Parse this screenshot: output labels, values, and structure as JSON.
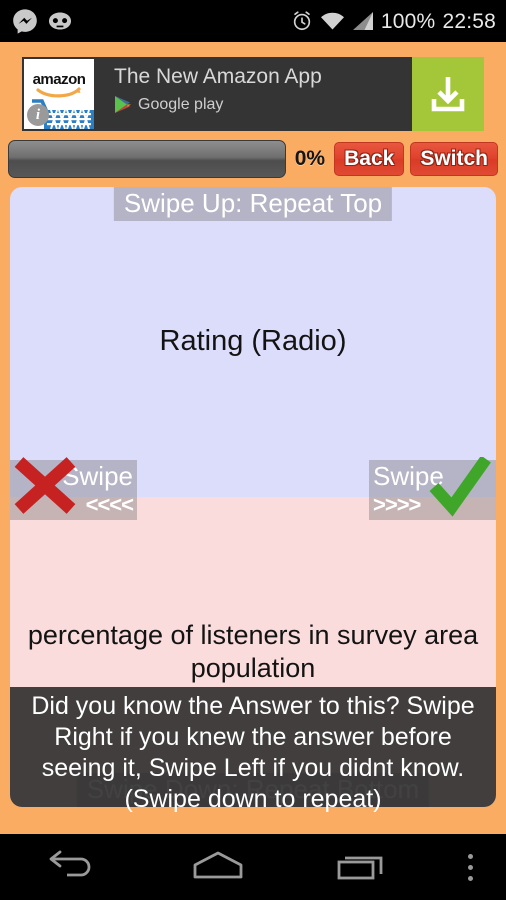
{
  "statusbar": {
    "icons_left": [
      "messenger-icon",
      "cyanogenmod-icon"
    ],
    "icons_right": [
      "alarm-icon",
      "wifi-icon",
      "signal-icon"
    ],
    "battery": "100%",
    "time": "22:58"
  },
  "ad": {
    "app_icon_label": "amazon",
    "title": "The New Amazon App",
    "store": "Google play",
    "cta_icon": "download-icon",
    "cta_color": "#A4C639",
    "background": "#343434"
  },
  "controls": {
    "progress_percent": 0,
    "progress_label": "0%",
    "back_label": "Back",
    "switch_label": "Switch",
    "button_color": "#E0412C"
  },
  "card": {
    "top": {
      "hint": "Swipe Up: Repeat Top",
      "text": "Rating (Radio)",
      "background": "#DCDCFB"
    },
    "bottom": {
      "hint": "Swipe Down: Repeat Bottom",
      "text": "percentage of listeners in survey area population",
      "background": "#FBDCDC"
    },
    "swipe_left": {
      "label": "Swipe",
      "arrows": "<<<<",
      "icon": "red-x-icon",
      "color": "#C62222"
    },
    "swipe_right": {
      "label": "Swipe",
      "arrows": ">>>>",
      "icon": "green-check-icon",
      "color": "#3FA62A"
    }
  },
  "overlay": {
    "text": "Did you know the Answer to this? Swipe Right if you knew the answer before seeing it, Swipe Left if you didnt know. (Swipe down to repeat)"
  },
  "navbar": {
    "back": "back-icon",
    "home": "home-icon",
    "recents": "recents-icon",
    "overflow": "overflow-menu-icon"
  },
  "theme": {
    "app_background": "#FBAC63"
  }
}
